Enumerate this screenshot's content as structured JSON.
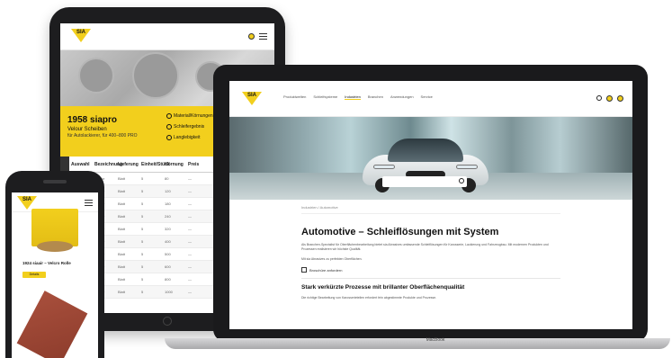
{
  "tablet": {
    "logo_text": "SIA",
    "hero_title": "1958 siapro",
    "hero_sub": "Velour Scheiben",
    "hero_sub2": "für Autolackierer, für 400–800 PRO",
    "features": [
      "Material/Körnungen",
      "Schleifergebnis",
      "Langlebigkeit"
    ],
    "table_headers": [
      "Auswahl",
      "Bezeichnung",
      "Lieferung",
      "Einheit/Stück",
      "Körnung",
      "Preis"
    ],
    "table_rows": [
      [
        "—",
        "Velour",
        "Blatt",
        "5",
        "80",
        "—"
      ],
      [
        "—",
        "Velour",
        "Blatt",
        "5",
        "120",
        "—"
      ],
      [
        "—",
        "Velour",
        "Blatt",
        "5",
        "180",
        "—"
      ],
      [
        "—",
        "Velour",
        "Blatt",
        "5",
        "240",
        "—"
      ],
      [
        "—",
        "Velour",
        "Blatt",
        "5",
        "320",
        "—"
      ],
      [
        "—",
        "Velour",
        "Blatt",
        "5",
        "400",
        "—"
      ],
      [
        "—",
        "Velour",
        "Blatt",
        "5",
        "500",
        "—"
      ],
      [
        "—",
        "Velour",
        "Blatt",
        "5",
        "600",
        "—"
      ],
      [
        "—",
        "Velour",
        "Blatt",
        "5",
        "800",
        "—"
      ],
      [
        "—",
        "Velour",
        "Blatt",
        "5",
        "1000",
        "—"
      ]
    ]
  },
  "laptop": {
    "logo_text": "SIA",
    "nav": [
      "Produktwelten",
      "Schleifsysteme",
      "Industrien",
      "Branchen",
      "Anwendungen",
      "Service"
    ],
    "nav_active_index": 2,
    "breadcrumb": "Industrien / Automotive",
    "headline": "Automotive – Schleiflösungen mit System",
    "paragraph": "Als Branchen-Spezialist für Oberflächenbearbeitung bietet sia Abrasives umfassende Schleiflösungen für Karosserie, Lackierung und Fahrzeugbau. Mit modernen Produkten und Prozessen realisieren wir höchste Qualität.",
    "paragraph2": "Mit sia Abrasives zu perfekten Oberflächen.",
    "checkbox_label": "Broschüre anfordern",
    "subheadline": "Stark verkürzte Prozesse mit brillanter Oberflächenqualität",
    "paragraph3": "Die richtige Bearbeitung von Karosserieteilen erfordert fein abgestimmte Produkte und Prozesse.",
    "base_label": "MacBook"
  },
  "phone": {
    "logo_text": "SIA",
    "product_title": "1924 siaair – Velcro Rolle",
    "button_label": "Details"
  },
  "colors": {
    "brand_yellow": "#f2cf1d",
    "device_body": "#1d1d1f"
  }
}
